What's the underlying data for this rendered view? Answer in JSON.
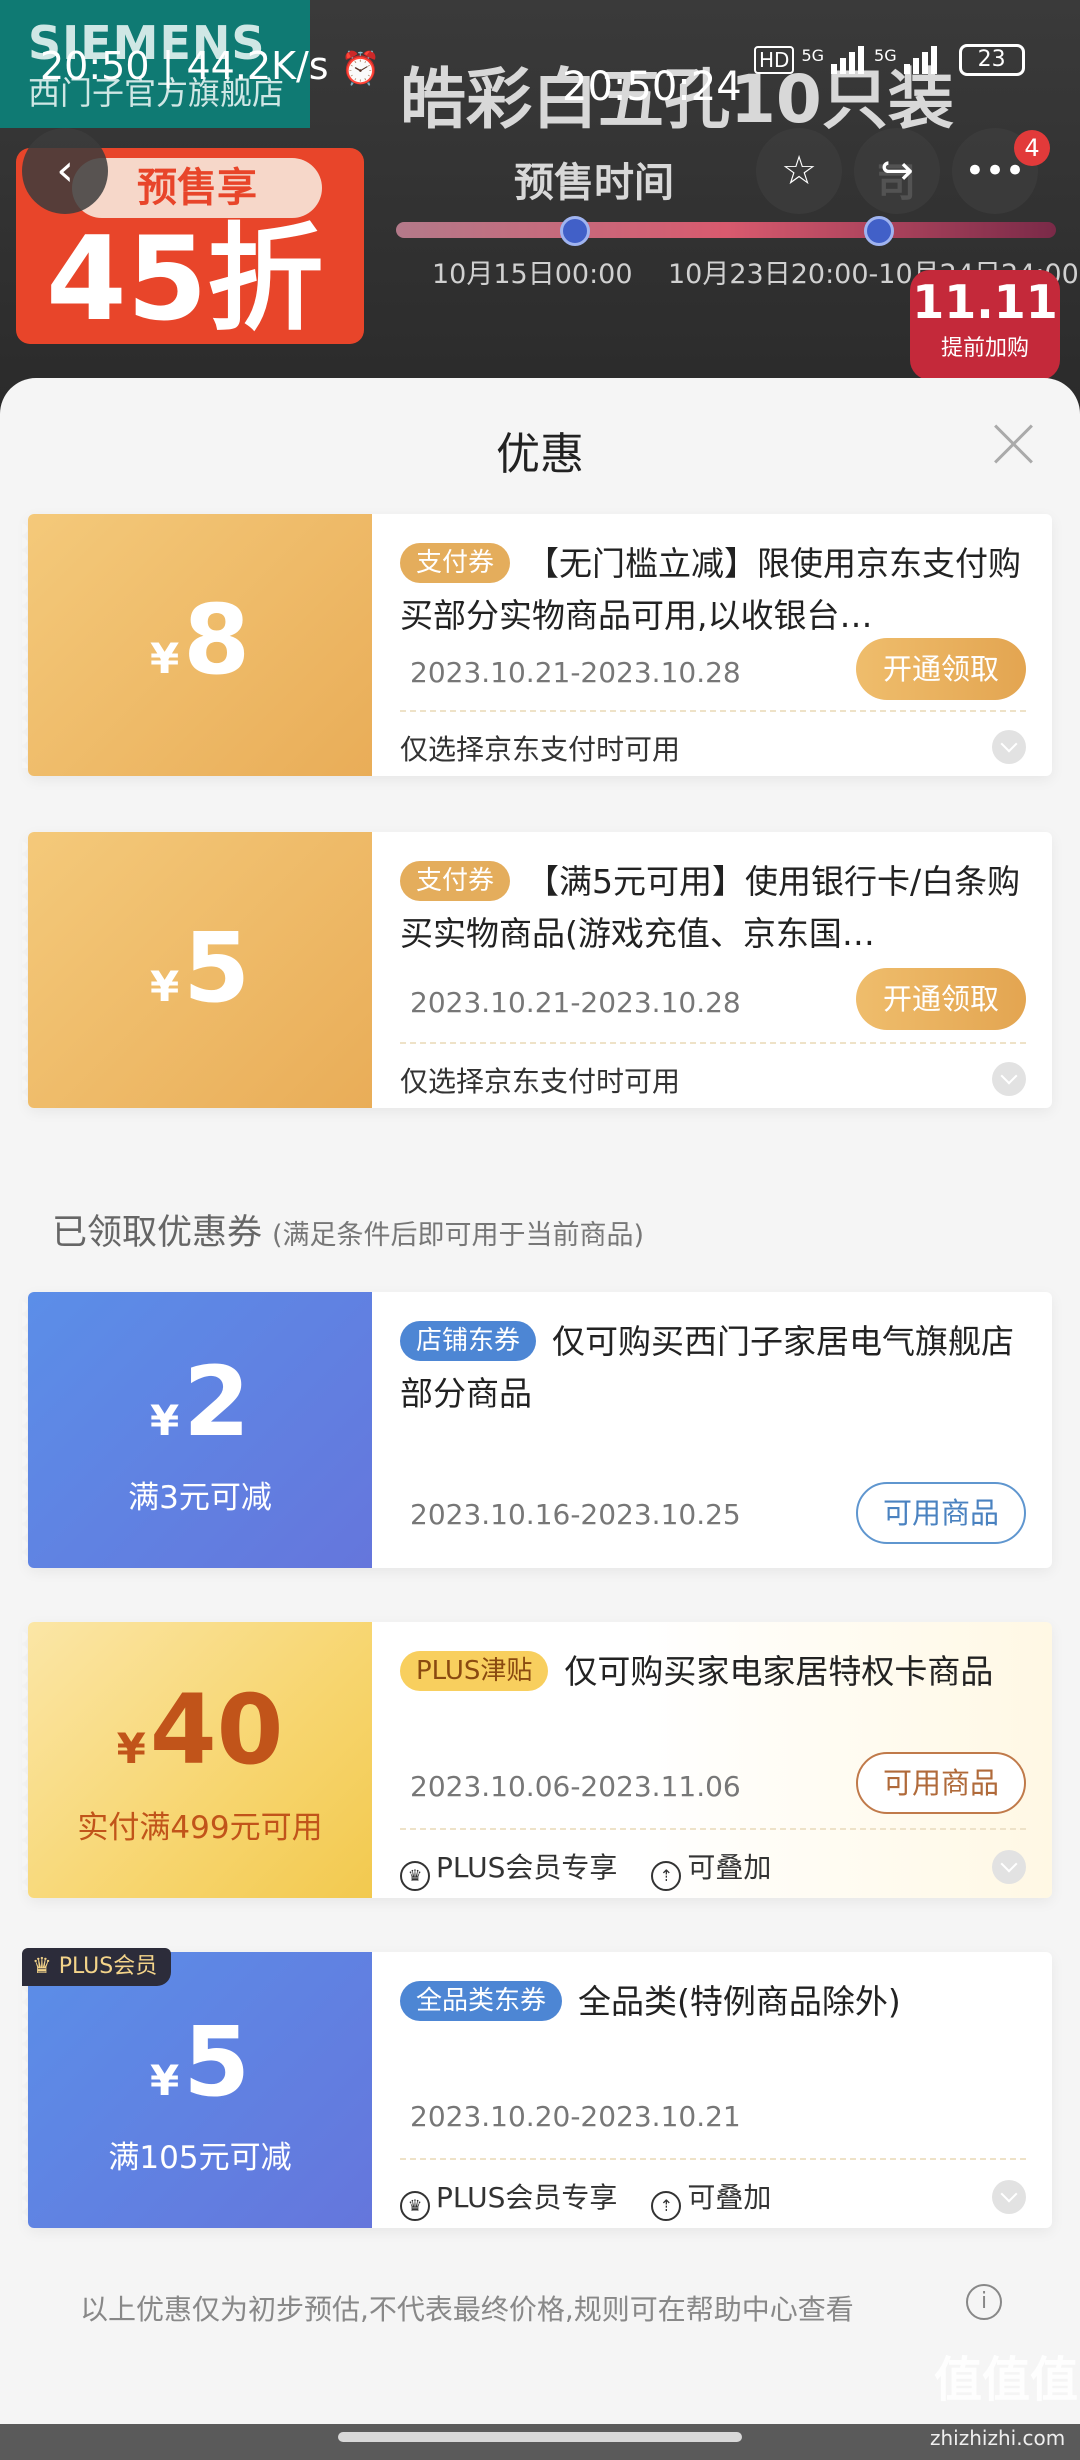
{
  "background": {
    "brand_line1": "SIEMENS",
    "brand_line2": "西门子官方旗舰店",
    "presale_tag": "预售享",
    "discount": "45折",
    "title": "皓彩白五孔10只装",
    "presale_time_label": "预售时间",
    "presale_label2": "司",
    "date1": "10月15日00:00",
    "date2": "10月23日20:00-10月24日24:00",
    "d11_num": "11.11",
    "d11_text": "提前加购"
  },
  "status_bar": {
    "left": "20:50 | 44.2K/s",
    "center": "20:50:24",
    "net1": "5G",
    "net2": "5G",
    "battery": "23"
  },
  "nav": {
    "back_icon": "‹",
    "badge": "4"
  },
  "panel": {
    "title": "优惠",
    "section_title": "已领取优惠券",
    "section_sub": "(满足条件后即可用于当前商品)",
    "footer": "以上优惠仅为初步预估,不代表最终价格,规则可在帮助中心查看"
  },
  "coupons": [
    {
      "yen": "¥",
      "amount": "8",
      "tag": "支付券",
      "desc": "【无门槛立减】限使用京东支付购买部分实物商品可用,以收银台…",
      "date": "2023.10.21-2023.10.28",
      "button": "开通领取",
      "note": "仅选择京东支付时可用"
    },
    {
      "yen": "¥",
      "amount": "5",
      "tag": "支付券",
      "desc": "【满5元可用】使用银行卡/白条购买实物商品(游戏充值、京东国…",
      "date": "2023.10.21-2023.10.28",
      "button": "开通领取",
      "note": "仅选择京东支付时可用"
    },
    {
      "yen": "¥",
      "amount": "2",
      "sub": "满3元可减",
      "tag": "店铺东券",
      "desc": "仅可购买西门子家居电气旗舰店部分商品",
      "date": "2023.10.16-2023.10.25",
      "button": "可用商品"
    },
    {
      "yen": "¥",
      "amount": "40",
      "sub": "实付满499元可用",
      "tag": "PLUS津贴",
      "desc": "仅可购买家电家居特权卡商品",
      "date": "2023.10.06-2023.11.06",
      "button": "可用商品",
      "feature1": "PLUS会员专享",
      "feature2": "可叠加"
    },
    {
      "badge": "PLUS会员",
      "yen": "¥",
      "amount": "5",
      "sub": "满105元可减",
      "tag": "全品类东券",
      "desc": "全品类(特例商品除外)",
      "date": "2023.10.20-2023.10.21",
      "feature1": "PLUS会员专享",
      "feature2": "可叠加"
    }
  ],
  "watermark": {
    "main": "值值值",
    "sub": "zhizhizhi.com"
  },
  "icons": [
    "back-icon",
    "star-icon",
    "share-icon",
    "more-icon",
    "close-icon",
    "chevron-down-icon",
    "crown-icon",
    "stack-icon",
    "info-icon",
    "alarm-icon"
  ]
}
